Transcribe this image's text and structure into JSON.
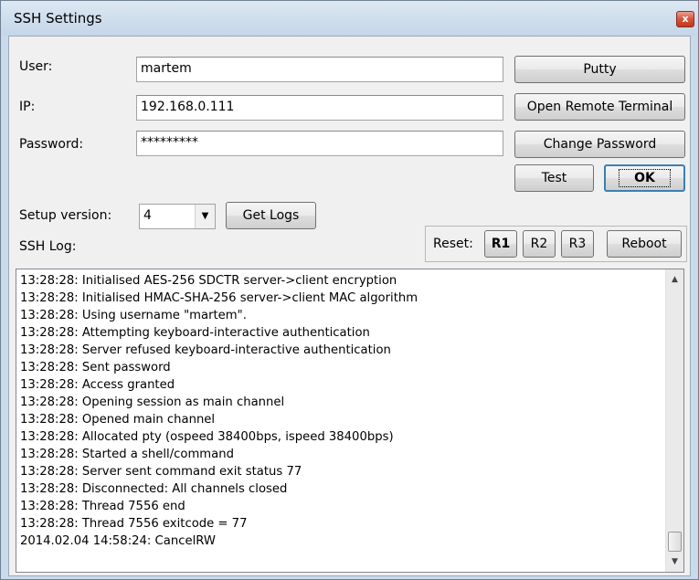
{
  "window": {
    "title": "SSH Settings",
    "close_glyph": "x"
  },
  "form": {
    "user_label": "User:",
    "user_value": "martem",
    "ip_label": "IP:",
    "ip_value": "192.168.0.111",
    "password_label": "Password:",
    "password_value": "*********",
    "setup_version_label": "Setup version:",
    "setup_version_value": "4",
    "ssh_log_label": "SSH Log:"
  },
  "buttons": {
    "putty": "Putty",
    "open_remote_terminal": "Open Remote Terminal",
    "change_password": "Change Password",
    "test": "Test",
    "ok": "OK",
    "get_logs": "Get Logs",
    "reset_label": "Reset:",
    "r1": "R1",
    "r2": "R2",
    "r3": "R3",
    "reboot": "Reboot"
  },
  "log": {
    "lines": [
      "13:28:28: Initialised AES-256 SDCTR server->client encryption",
      "13:28:28: Initialised HMAC-SHA-256 server->client MAC algorithm",
      "13:28:28: Using username \"martem\".",
      "13:28:28: Attempting keyboard-interactive authentication",
      "13:28:28: Server refused keyboard-interactive authentication",
      "13:28:28: Sent password",
      "13:28:28: Access granted",
      "13:28:28: Opening session as main channel",
      "13:28:28: Opened main channel",
      "13:28:28: Allocated pty (ospeed 38400bps, ispeed 38400bps)",
      "13:28:28: Started a shell/command",
      "13:28:28: Server sent command exit status 77",
      "13:28:28: Disconnected: All channels closed",
      "13:28:28: Thread 7556 end",
      "13:28:28: Thread 7556 exitcode = 77",
      "2014.02.04 14:58:24: CancelRW"
    ]
  },
  "icons": {
    "close": "close-icon",
    "dropdown": "chevron-down-icon",
    "scroll_up": "arrow-up-icon",
    "scroll_down": "arrow-down-icon"
  },
  "colors": {
    "window_frame": "#c9daea",
    "client_bg": "#f0f0f0",
    "close_button": "#c0391f",
    "ok_focus_border": "#3c7fb1"
  }
}
